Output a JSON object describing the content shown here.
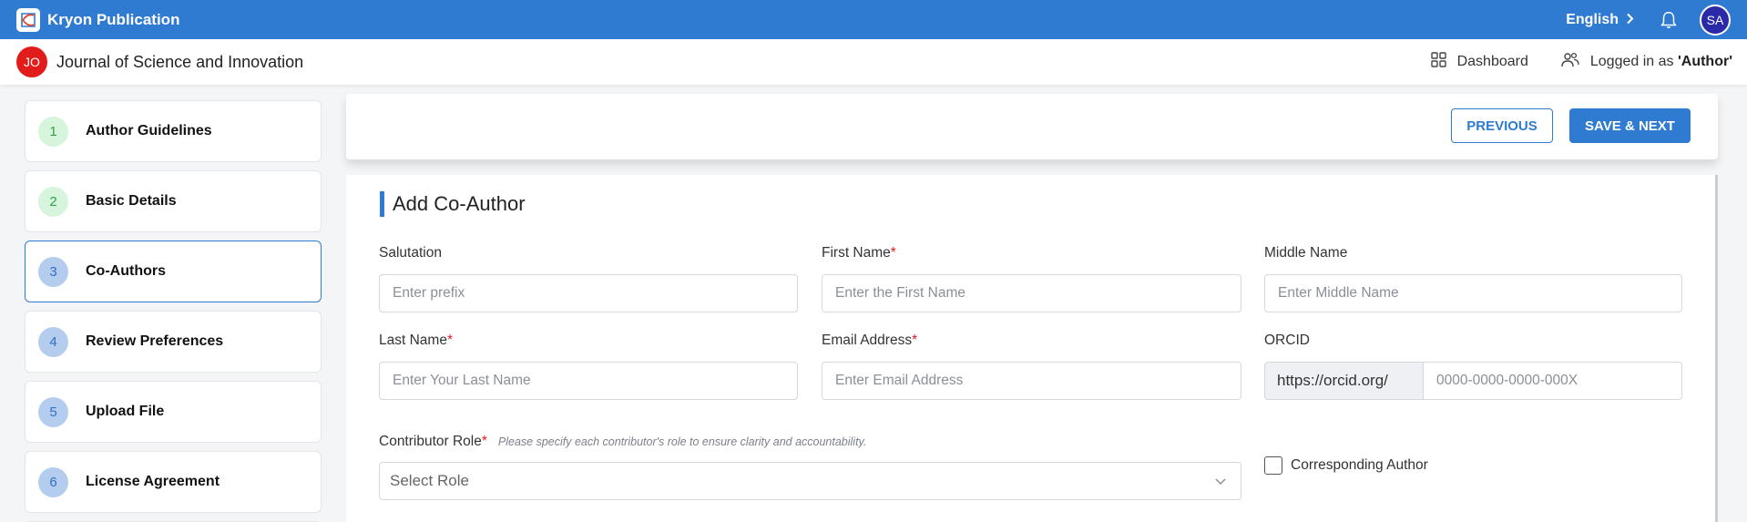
{
  "topbar": {
    "brand": "Kryon Publication",
    "language": "English",
    "user_initials": "SA"
  },
  "journal": {
    "badge": "JO",
    "title": "Journal of Science and Innovation",
    "dashboard_label": "Dashboard",
    "logged_in_prefix": "Logged in as ",
    "logged_in_role": "'Author'"
  },
  "steps": [
    {
      "num": "1",
      "label": "Author Guidelines",
      "state": "done"
    },
    {
      "num": "2",
      "label": "Basic Details",
      "state": "done"
    },
    {
      "num": "3",
      "label": "Co-Authors",
      "state": "active"
    },
    {
      "num": "4",
      "label": "Review Preferences",
      "state": "todo"
    },
    {
      "num": "5",
      "label": "Upload File",
      "state": "todo"
    },
    {
      "num": "6",
      "label": "License Agreement",
      "state": "todo"
    }
  ],
  "actions": {
    "previous": "PREVIOUS",
    "save_next": "SAVE & NEXT"
  },
  "form": {
    "title": "Add Co-Author",
    "salutation": {
      "label": "Salutation",
      "placeholder": "Enter prefix"
    },
    "first_name": {
      "label": "First Name",
      "placeholder": "Enter the First Name"
    },
    "middle_name": {
      "label": "Middle Name",
      "placeholder": "Enter Middle Name"
    },
    "last_name": {
      "label": "Last Name",
      "placeholder": "Enter Your Last Name"
    },
    "email": {
      "label": "Email Address",
      "placeholder": "Enter Email Address"
    },
    "orcid": {
      "label": "ORCID",
      "prefix": "https://orcid.org/",
      "placeholder": "0000-0000-0000-000X"
    },
    "contributor_role": {
      "label": "Contributor Role",
      "hint": "Please specify each contributor's role to ensure clarity and accountability.",
      "selected": "Select Role"
    },
    "corresponding_author": "Corresponding Author",
    "required_mark": "*"
  },
  "colors": {
    "primary": "#2f7bd1",
    "required": "#e21b1b",
    "step_done_bg": "#d6f5dc",
    "step_todo_bg": "#b4cdef"
  }
}
